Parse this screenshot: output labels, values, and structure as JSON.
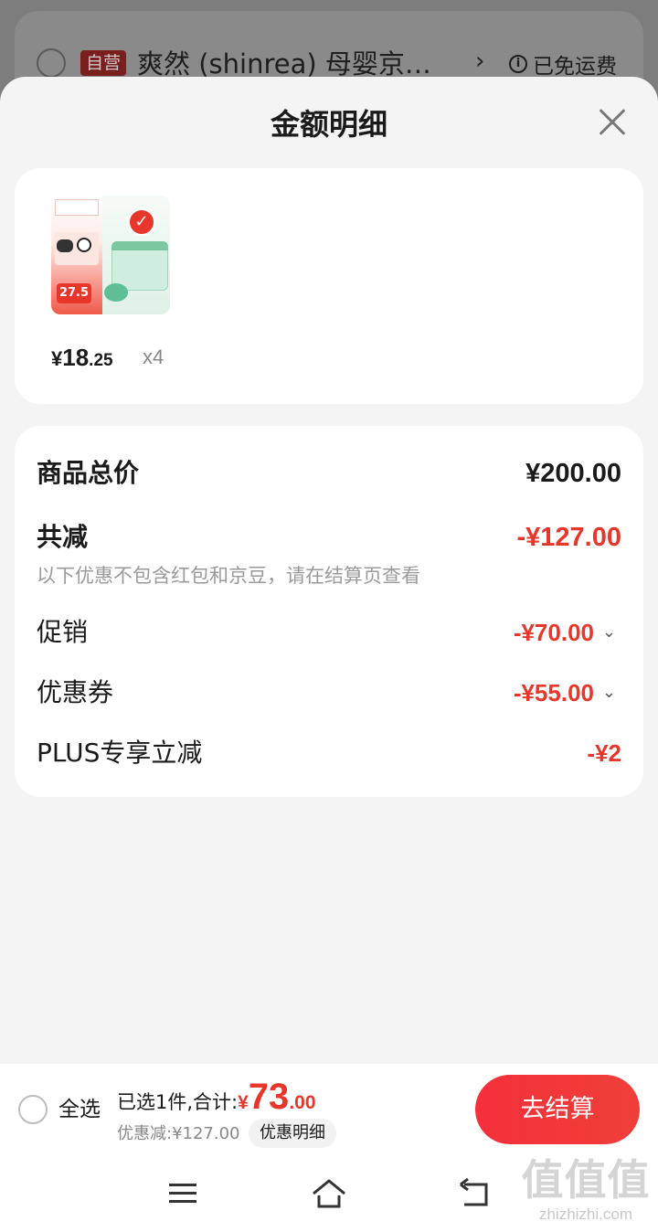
{
  "background_store_row": {
    "badge": "自营",
    "store_name": "爽然 (shinrea) 母婴京…",
    "shipping": "已免运费"
  },
  "sheet": {
    "title": "金额明细"
  },
  "product": {
    "price_symbol": "¥",
    "price_integer": "18",
    "price_decimal": ".25",
    "quantity": "x4",
    "thumbnail_badge_price": "27.5"
  },
  "breakdown": {
    "total_label": "商品总价",
    "total_value": "¥200.00",
    "reduction_label": "共减",
    "reduction_value": "-¥127.00",
    "note": "以下优惠不包含红包和京豆，请在结算页查看",
    "promo_label": "促销",
    "promo_value": "-¥70.00",
    "coupon_label": "优惠券",
    "coupon_value": "-¥55.00",
    "plus_label": "PLUS专享立减",
    "plus_value": "-¥2"
  },
  "bottom_bar": {
    "select_all": "全选",
    "summary_prefix": "已选1件,合计:",
    "total_symbol": "¥",
    "total_integer": "73",
    "total_decimal": ".00",
    "saved": "优惠减:¥127.00",
    "detail_button": "优惠明细",
    "checkout_button": "去结算"
  },
  "watermark": {
    "main": "值值值",
    "site": "zhizhizhi.com"
  },
  "colors": {
    "accent_red": "#e8362a",
    "checkout_gradient": "#f4303a"
  }
}
